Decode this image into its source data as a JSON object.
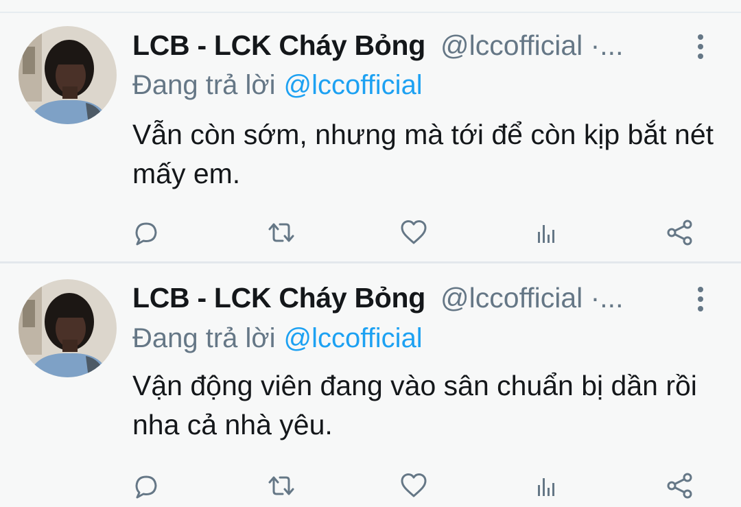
{
  "tweets": [
    {
      "display_name": "LCB - LCK Cháy Bỏng",
      "handle": "@lccofficial ·...",
      "reply_prefix": "Đang trả lời",
      "reply_to": "@lccofficial",
      "text": "Vẫn còn sớm, nhưng mà tới để còn kịp bắt nét mấy em."
    },
    {
      "display_name": "LCB - LCK Cháy Bỏng",
      "handle": "@lccofficial ·...",
      "reply_prefix": "Đang trả lời",
      "reply_to": "@lccofficial",
      "text": "Vận động viên đang vào sân chuẩn bị dần rồi nha cả nhà yêu."
    }
  ],
  "icons": {
    "reply": "reply-icon",
    "retweet": "retweet-icon",
    "like": "heart-icon",
    "stats": "analytics-icon",
    "share": "share-icon",
    "more": "more-vertical-icon"
  },
  "colors": {
    "background": "#f7f8f8",
    "text_primary": "#14171a",
    "text_secondary": "#657786",
    "link": "#1da1f2",
    "icon": "#657786"
  }
}
